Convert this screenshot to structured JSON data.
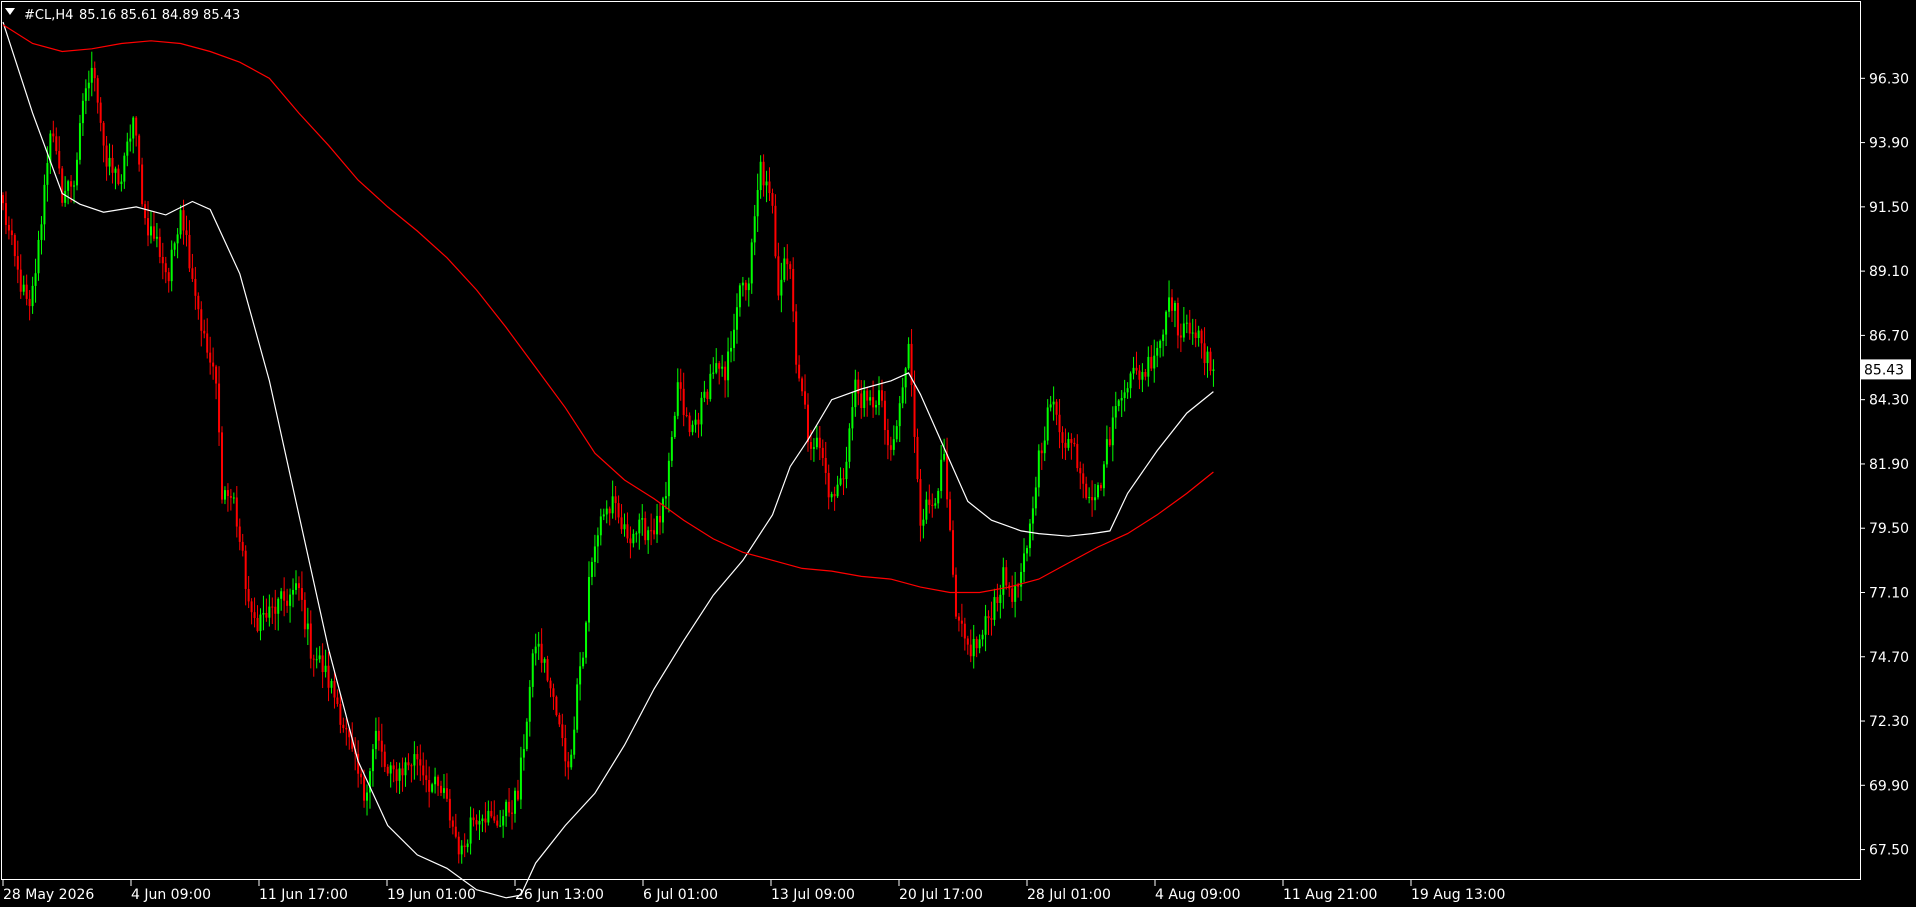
{
  "header": {
    "symbol_timeframe": "#CL,H4",
    "ohlc": "85.16 85.61 84.89 85.43"
  },
  "colors": {
    "background": "#000000",
    "frame": "#ffffff",
    "bull": "#00ff00",
    "bear": "#ff0000",
    "ma_fast": "#ffffff",
    "ma_slow": "#ff0000"
  },
  "chart_data": {
    "type": "candlestick",
    "ylim": [
      66.7,
      99.0
    ],
    "y_ticks": [
      "96.30",
      "93.90",
      "91.50",
      "89.10",
      "86.70",
      "84.30",
      "81.90",
      "79.50",
      "77.10",
      "74.70",
      "72.30",
      "69.90",
      "67.50"
    ],
    "x_ticks": [
      "28 May 2026",
      "4 Jun 09:00",
      "11 Jun 17:00",
      "19 Jun 01:00",
      "26 Jun 13:00",
      "6 Jul 01:00",
      "13 Jul 09:00",
      "20 Jul 17:00",
      "28 Jul 01:00",
      "4 Aug 09:00",
      "11 Aug 21:00",
      "19 Aug 13:00"
    ],
    "last_price": "85.43",
    "price_waypoints": [
      [
        0,
        91.5
      ],
      [
        5,
        89.0
      ],
      [
        9,
        87.5
      ],
      [
        12,
        90.0
      ],
      [
        16,
        94.5
      ],
      [
        20,
        92.0
      ],
      [
        24,
        92.5
      ],
      [
        28,
        96.0
      ],
      [
        31,
        96.6
      ],
      [
        35,
        93.0
      ],
      [
        40,
        92.5
      ],
      [
        44,
        94.8
      ],
      [
        48,
        91.0
      ],
      [
        52,
        90.2
      ],
      [
        56,
        88.8
      ],
      [
        60,
        91.6
      ],
      [
        64,
        89.0
      ],
      [
        68,
        86.5
      ],
      [
        72,
        84.8
      ],
      [
        74,
        81.0
      ],
      [
        78,
        80.5
      ],
      [
        84,
        76.0
      ],
      [
        90,
        76.3
      ],
      [
        95,
        76.8
      ],
      [
        100,
        77.2
      ],
      [
        104,
        75.0
      ],
      [
        108,
        74.3
      ],
      [
        113,
        73.0
      ],
      [
        118,
        71.0
      ],
      [
        122,
        69.5
      ],
      [
        126,
        71.8
      ],
      [
        130,
        70.2
      ],
      [
        136,
        70.6
      ],
      [
        140,
        71.0
      ],
      [
        144,
        70.0
      ],
      [
        149,
        69.5
      ],
      [
        153,
        68.0
      ],
      [
        155,
        67.3
      ],
      [
        158,
        68.6
      ],
      [
        162,
        69.0
      ],
      [
        166,
        68.4
      ],
      [
        170,
        68.9
      ],
      [
        174,
        69.5
      ],
      [
        178,
        73.5
      ],
      [
        180,
        75.3
      ],
      [
        184,
        74.0
      ],
      [
        188,
        72.0
      ],
      [
        190,
        71.0
      ],
      [
        192,
        70.8
      ],
      [
        194,
        74.0
      ],
      [
        196,
        74.7
      ],
      [
        198,
        77.5
      ],
      [
        202,
        80.0
      ],
      [
        206,
        80.3
      ],
      [
        210,
        79.3
      ],
      [
        214,
        79.4
      ],
      [
        218,
        79.5
      ],
      [
        221,
        79.6
      ],
      [
        224,
        80.5
      ],
      [
        228,
        84.8
      ],
      [
        232,
        83.0
      ],
      [
        236,
        84.0
      ],
      [
        240,
        85.5
      ],
      [
        244,
        85.0
      ],
      [
        248,
        88.0
      ],
      [
        252,
        88.8
      ],
      [
        256,
        93.0
      ],
      [
        260,
        91.3
      ],
      [
        262,
        88.5
      ],
      [
        264,
        89.8
      ],
      [
        266,
        89.2
      ],
      [
        268,
        86.0
      ],
      [
        272,
        83.0
      ],
      [
        276,
        82.5
      ],
      [
        280,
        80.5
      ],
      [
        284,
        81.5
      ],
      [
        288,
        84.8
      ],
      [
        292,
        84.0
      ],
      [
        296,
        84.5
      ],
      [
        300,
        82.0
      ],
      [
        303,
        84.0
      ],
      [
        306,
        86.2
      ],
      [
        310,
        80.0
      ],
      [
        314,
        80.5
      ],
      [
        318,
        82.0
      ],
      [
        322,
        76.0
      ],
      [
        326,
        75.0
      ],
      [
        330,
        75.2
      ],
      [
        334,
        76.5
      ],
      [
        338,
        77.6
      ],
      [
        342,
        77.0
      ],
      [
        346,
        78.5
      ],
      [
        350,
        82.2
      ],
      [
        354,
        84.2
      ],
      [
        358,
        83.0
      ],
      [
        362,
        82.5
      ],
      [
        366,
        81.0
      ],
      [
        370,
        80.8
      ],
      [
        374,
        83.0
      ],
      [
        378,
        84.8
      ],
      [
        382,
        85.2
      ],
      [
        386,
        85.4
      ],
      [
        390,
        86.4
      ],
      [
        392,
        86.8
      ],
      [
        394,
        88.5
      ],
      [
        398,
        86.6
      ],
      [
        402,
        87.2
      ],
      [
        406,
        85.8
      ],
      [
        409,
        85.43
      ]
    ],
    "series": [
      {
        "name": "",
        "type": "ma_fast",
        "points": [
          [
            0,
            98.4
          ],
          [
            10,
            95.0
          ],
          [
            20,
            92.0
          ],
          [
            26,
            91.6
          ],
          [
            34,
            91.3
          ],
          [
            45,
            91.5
          ],
          [
            55,
            91.2
          ],
          [
            64,
            91.7
          ],
          [
            70,
            91.4
          ],
          [
            80,
            89.0
          ],
          [
            90,
            85.0
          ],
          [
            100,
            80.0
          ],
          [
            110,
            75.0
          ],
          [
            120,
            70.8
          ],
          [
            130,
            68.4
          ],
          [
            140,
            67.3
          ],
          [
            150,
            66.8
          ],
          [
            160,
            66.0
          ],
          [
            170,
            65.7
          ],
          [
            175,
            65.8
          ],
          [
            180,
            67.0
          ],
          [
            190,
            68.4
          ],
          [
            200,
            69.6
          ],
          [
            210,
            71.4
          ],
          [
            220,
            73.5
          ],
          [
            230,
            75.3
          ],
          [
            240,
            77.0
          ],
          [
            250,
            78.3
          ],
          [
            260,
            80.0
          ],
          [
            266,
            81.8
          ],
          [
            272,
            82.8
          ],
          [
            280,
            84.3
          ],
          [
            290,
            84.7
          ],
          [
            300,
            85.0
          ],
          [
            306,
            85.3
          ],
          [
            310,
            84.5
          ],
          [
            318,
            82.5
          ],
          [
            326,
            80.5
          ],
          [
            334,
            79.8
          ],
          [
            344,
            79.4
          ],
          [
            350,
            79.3
          ],
          [
            360,
            79.2
          ],
          [
            368,
            79.3
          ],
          [
            374,
            79.4
          ],
          [
            380,
            80.8
          ],
          [
            390,
            82.4
          ],
          [
            400,
            83.8
          ],
          [
            409,
            84.6
          ]
        ]
      },
      {
        "name": "",
        "type": "ma_slow",
        "points": [
          [
            0,
            98.3
          ],
          [
            10,
            97.6
          ],
          [
            20,
            97.3
          ],
          [
            30,
            97.4
          ],
          [
            40,
            97.6
          ],
          [
            50,
            97.7
          ],
          [
            60,
            97.6
          ],
          [
            70,
            97.3
          ],
          [
            80,
            96.9
          ],
          [
            90,
            96.3
          ],
          [
            100,
            95.0
          ],
          [
            110,
            93.8
          ],
          [
            120,
            92.5
          ],
          [
            130,
            91.5
          ],
          [
            140,
            90.6
          ],
          [
            150,
            89.6
          ],
          [
            160,
            88.4
          ],
          [
            170,
            87.0
          ],
          [
            180,
            85.5
          ],
          [
            190,
            84.0
          ],
          [
            200,
            82.3
          ],
          [
            210,
            81.3
          ],
          [
            220,
            80.6
          ],
          [
            230,
            79.8
          ],
          [
            240,
            79.1
          ],
          [
            250,
            78.6
          ],
          [
            260,
            78.3
          ],
          [
            270,
            78.0
          ],
          [
            280,
            77.9
          ],
          [
            290,
            77.7
          ],
          [
            300,
            77.6
          ],
          [
            310,
            77.3
          ],
          [
            320,
            77.1
          ],
          [
            330,
            77.1
          ],
          [
            340,
            77.3
          ],
          [
            350,
            77.6
          ],
          [
            360,
            78.2
          ],
          [
            370,
            78.8
          ],
          [
            380,
            79.3
          ],
          [
            390,
            80.0
          ],
          [
            400,
            80.8
          ],
          [
            409,
            81.6
          ]
        ]
      }
    ]
  }
}
